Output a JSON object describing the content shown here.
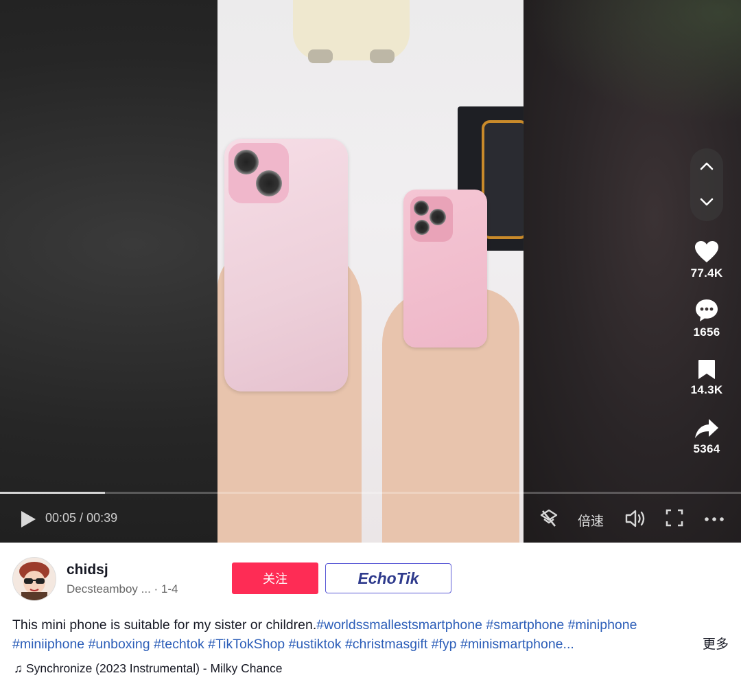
{
  "player": {
    "current_time": "00:05",
    "time_separator": " / ",
    "duration": "00:39",
    "progress_fraction": 0.142,
    "speed_label": "倍速"
  },
  "actions": {
    "likes": "77.4K",
    "comments": "1656",
    "saves": "14.3K",
    "shares": "5364"
  },
  "author": {
    "username": "chidsj",
    "subtitle_name": "Decsteamboy ...",
    "subtitle_date": " · 1-4",
    "follow_label": "关注",
    "echotik_label": "EchoTik"
  },
  "description": {
    "text": "This mini phone is suitable for my sister or children.",
    "tags_line1": [
      "#worldssmallestsmartphone",
      "#smartphone",
      "#miniphone"
    ],
    "tags_line2": [
      "#miniiphone",
      "#unboxing",
      "#techtok",
      "#TikTokShop",
      "#ustiktok",
      "#christmasgift",
      "#fyp",
      "#minismartphone..."
    ],
    "more_label": "更多"
  },
  "music": {
    "note_glyph": "♫",
    "title": "Synchronize (2023 Instrumental) - Milky Chance"
  },
  "colors": {
    "follow_bg": "#fe2c55",
    "hashtag": "#2b5db8"
  },
  "icons": [
    "chevron-up-icon",
    "chevron-down-icon",
    "heart-icon",
    "comment-icon",
    "bookmark-icon",
    "share-icon",
    "play-icon",
    "clear-screen-icon",
    "volume-icon",
    "fullscreen-icon",
    "more-icon"
  ]
}
